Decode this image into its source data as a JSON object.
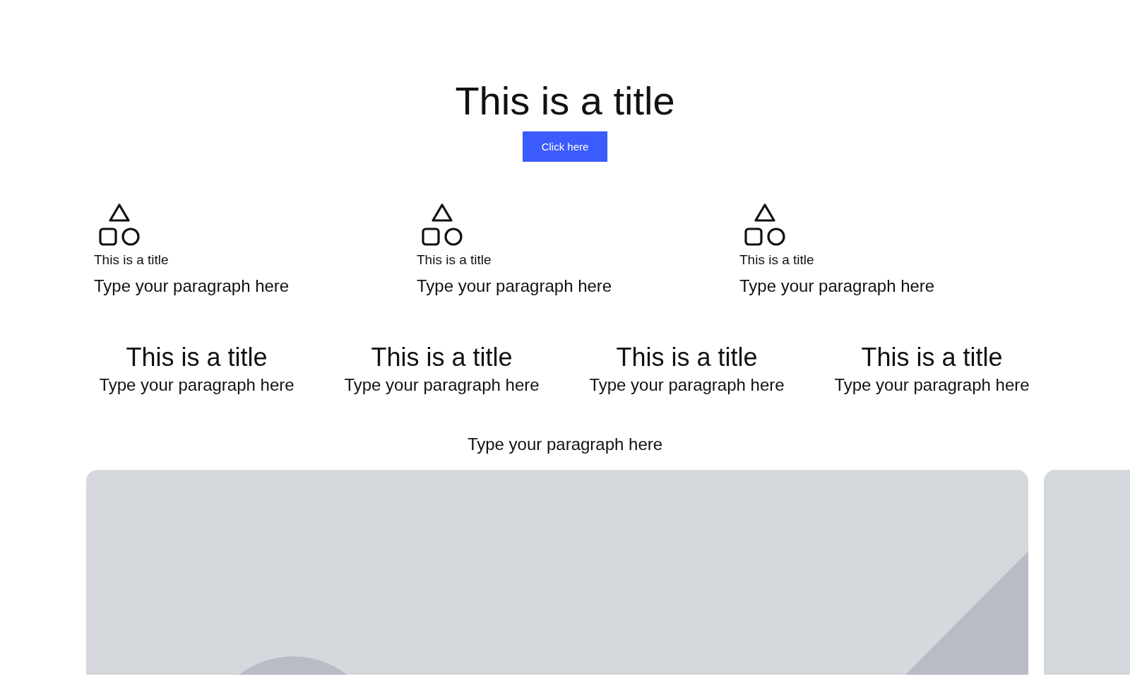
{
  "hero": {
    "title": "This is a title",
    "button": "Click here"
  },
  "features": [
    {
      "title": "This is a title",
      "paragraph": "Type your paragraph here"
    },
    {
      "title": "This is a title",
      "paragraph": "Type your paragraph here"
    },
    {
      "title": "This is a title",
      "paragraph": "Type your paragraph here"
    }
  ],
  "columns": [
    {
      "title": "This is a title",
      "paragraph": "Type your paragraph here"
    },
    {
      "title": "This is a title",
      "paragraph": "Type your paragraph here"
    },
    {
      "title": "This is a title",
      "paragraph": "Type your paragraph here"
    },
    {
      "title": "This is a title",
      "paragraph": "Type your paragraph here"
    }
  ],
  "caption": "Type your paragraph here"
}
